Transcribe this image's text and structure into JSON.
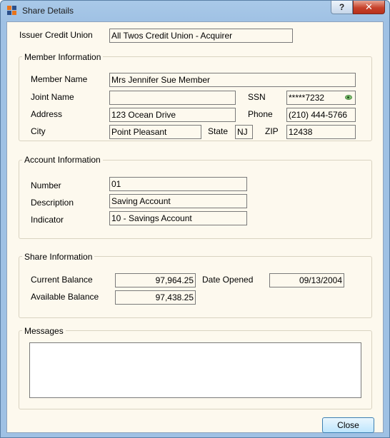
{
  "window": {
    "title": "Share Details",
    "help_label": "?",
    "close_glyph": "✕",
    "icon": "app-logo-icon"
  },
  "issuer": {
    "label": "Issuer Credit Union",
    "value": "All Twos Credit Union - Acquirer"
  },
  "member": {
    "group_title": "Member Information",
    "name_label": "Member Name",
    "name_value": "Mrs Jennifer Sue Member",
    "joint_label": "Joint Name",
    "joint_value": "",
    "ssn_label": "SSN",
    "ssn_value": "*****7232",
    "address_label": "Address",
    "address_value": "123 Ocean Drive",
    "phone_label": "Phone",
    "phone_value": "(210) 444-5766",
    "city_label": "City",
    "city_value": "Point Pleasant",
    "state_label": "State",
    "state_value": "NJ",
    "zip_label": "ZIP",
    "zip_value": "12438"
  },
  "account": {
    "group_title": "Account Information",
    "number_label": "Number",
    "number_value": "01",
    "description_label": "Description",
    "description_value": "Saving Account",
    "indicator_label": "Indicator",
    "indicator_value": "10 - Savings Account"
  },
  "share": {
    "group_title": "Share Information",
    "current_balance_label": "Current Balance",
    "current_balance_value": "97,964.25",
    "available_balance_label": "Available Balance",
    "available_balance_value": "97,438.25",
    "date_opened_label": "Date Opened",
    "date_opened_value": "09/13/2004"
  },
  "messages": {
    "group_title": "Messages",
    "value": ""
  },
  "footer": {
    "close_label": "Close"
  },
  "colors": {
    "frame": "#9fc1e4",
    "client_bg": "#fdf9ee",
    "close_red": "#c7422b"
  }
}
